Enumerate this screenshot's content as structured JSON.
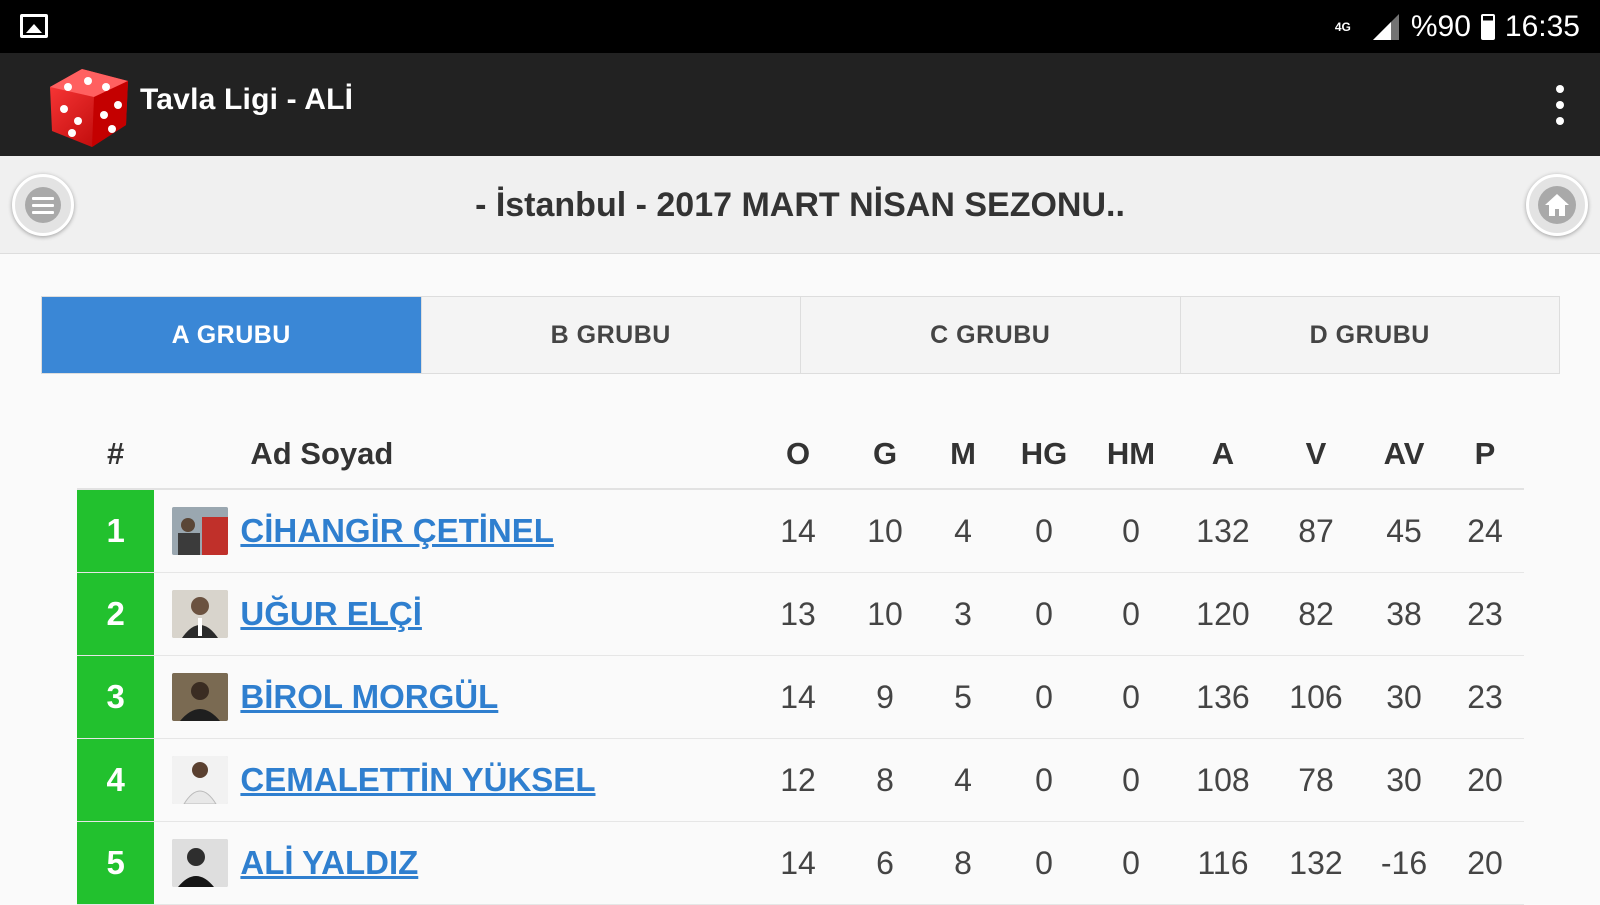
{
  "status_bar": {
    "network": "4G",
    "battery": "%90",
    "time": "16:35",
    "icons": [
      "image-notification-icon",
      "signal-icon",
      "battery-icon"
    ]
  },
  "app_bar": {
    "title": "Tavla Ligi - ALİ",
    "logo_icon": "dice-icon",
    "overflow_icon": "more-vert-icon"
  },
  "season": {
    "title": "- İstanbul - 2017 MART NİSAN SEZONU..",
    "menu_icon": "menu-icon",
    "home_icon": "home-icon"
  },
  "tabs": [
    {
      "label": "A GRUBU",
      "active": true
    },
    {
      "label": "B GRUBU",
      "active": false
    },
    {
      "label": "C GRUBU",
      "active": false
    },
    {
      "label": "D GRUBU",
      "active": false
    }
  ],
  "table": {
    "headers": {
      "rank": "#",
      "name": "Ad Soyad",
      "o": "O",
      "g": "G",
      "m": "M",
      "hg": "HG",
      "hm": "HM",
      "a": "A",
      "v": "V",
      "av": "AV",
      "p": "P"
    },
    "rows": [
      {
        "rank": "1",
        "name": "CİHANGİR ÇETİNEL",
        "o": "14",
        "g": "10",
        "m": "4",
        "hg": "0",
        "hm": "0",
        "a": "132",
        "v": "87",
        "av": "45",
        "p": "24"
      },
      {
        "rank": "2",
        "name": "UĞUR ELÇİ",
        "o": "13",
        "g": "10",
        "m": "3",
        "hg": "0",
        "hm": "0",
        "a": "120",
        "v": "82",
        "av": "38",
        "p": "23"
      },
      {
        "rank": "3",
        "name": "BİROL MORGÜL",
        "o": "14",
        "g": "9",
        "m": "5",
        "hg": "0",
        "hm": "0",
        "a": "136",
        "v": "106",
        "av": "30",
        "p": "23"
      },
      {
        "rank": "4",
        "name": "CEMALETTİN YÜKSEL",
        "o": "12",
        "g": "8",
        "m": "4",
        "hg": "0",
        "hm": "0",
        "a": "108",
        "v": "78",
        "av": "30",
        "p": "20"
      },
      {
        "rank": "5",
        "name": "ALİ YALDIZ",
        "o": "14",
        "g": "6",
        "m": "8",
        "hg": "0",
        "hm": "0",
        "a": "116",
        "v": "132",
        "av": "-16",
        "p": "20"
      }
    ]
  },
  "colors": {
    "status_bar": "#000000",
    "app_bar": "#222222",
    "active_tab": "#3a87d6",
    "rank_cell": "#22c12e",
    "player_link": "#2f7fcf"
  }
}
